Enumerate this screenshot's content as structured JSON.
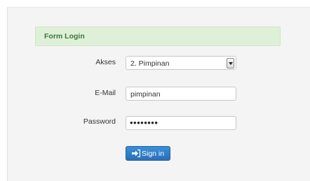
{
  "form": {
    "title": "Form Login",
    "akses": {
      "label": "Akses",
      "value": "2. Pimpinan"
    },
    "email": {
      "label": "E-Mail",
      "value": "pimpinan"
    },
    "password": {
      "label": "Password",
      "value": "••••••••"
    },
    "submit": {
      "label": "Sign in",
      "icon": "sign-in-icon"
    }
  },
  "colors": {
    "alert_bg": "#dff0d8",
    "alert_text": "#3c763d",
    "button_bg": "#2a6fb8"
  }
}
